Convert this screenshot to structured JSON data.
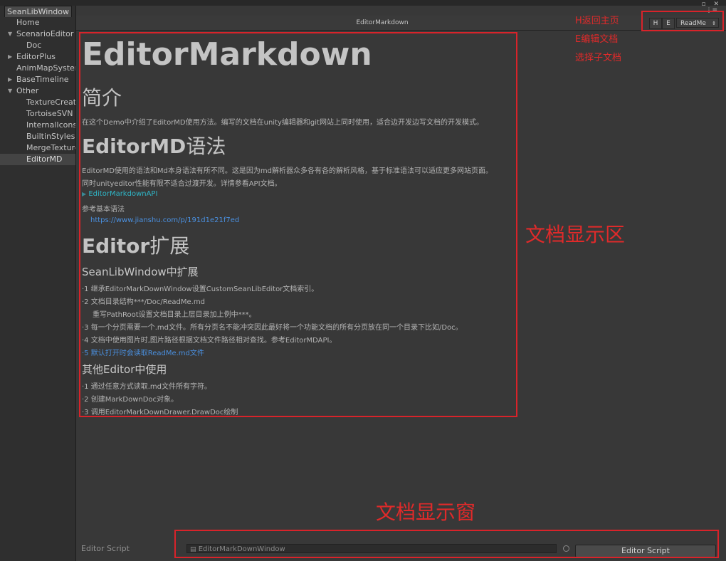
{
  "window": {
    "tab": "SeanLibWindow",
    "controls": "▫ ✕"
  },
  "sidebar": {
    "items": [
      {
        "label": "Home",
        "indent": 1,
        "arrow": "",
        "selected": false
      },
      {
        "label": "ScenarioEditor",
        "indent": 1,
        "arrow": "▼",
        "selected": false
      },
      {
        "label": "Doc",
        "indent": 2,
        "arrow": "",
        "selected": false
      },
      {
        "label": "EditorPlus",
        "indent": 1,
        "arrow": "▶",
        "selected": false
      },
      {
        "label": "AnimMapSystem",
        "indent": 1,
        "arrow": "",
        "selected": false
      },
      {
        "label": "BaseTimeline",
        "indent": 1,
        "arrow": "▶",
        "selected": false
      },
      {
        "label": "Other",
        "indent": 1,
        "arrow": "▼",
        "selected": false
      },
      {
        "label": "TextureCreator",
        "indent": 2,
        "arrow": "",
        "selected": false
      },
      {
        "label": "TortoiseSVN",
        "indent": 2,
        "arrow": "",
        "selected": false
      },
      {
        "label": "InternalIcons",
        "indent": 2,
        "arrow": "",
        "selected": false
      },
      {
        "label": "BuiltinStyles",
        "indent": 2,
        "arrow": "",
        "selected": false
      },
      {
        "label": "MergeTexture",
        "indent": 2,
        "arrow": "",
        "selected": false
      },
      {
        "label": "EditorMD",
        "indent": 2,
        "arrow": "",
        "selected": true
      }
    ]
  },
  "header": {
    "title": "EditorMarkdown",
    "home_button": "H",
    "edit_button": "E",
    "doc_select": "ReadMe",
    "menu_icon": "⋮≡"
  },
  "doc": {
    "h1": "EditorMarkdown",
    "intro_heading": "简介",
    "intro_text": "在这个Demo中介绍了EditorMD使用方法。编写的文档在unity编辑器和git网站上同时使用，适合边开发边写文档的开发模式。",
    "syntax_heading_bold": "EditorMD",
    "syntax_heading_rest": "语法",
    "syntax_line1": "EditorMD使用的语法和Md本身语法有所不同。这是因为md解析器众多各有各的解析风格，基于标准语法可以适应更多网站页面。",
    "syntax_line2": "同时unityeditor性能有限不适合过渡开发。详情参看API文档。",
    "api_link": "EditorMarkdownAPI",
    "ref_label": "参考基本语法",
    "ref_url": "https://www.jianshu.com/p/191d1e21f7ed",
    "ext_heading_bold": "Editor",
    "ext_heading_rest": "扩展",
    "sean_heading": "SeanLibWindow中扩展",
    "sean_items": [
      "·1 继承EditorMarkDownWindow设置CustomSeanLibEditor文档索引。",
      "·2 文档目录结构***/Doc/ReadMe.md",
      "重写PathRoot设置文档目录上层目录加上例中***。",
      "·3 每一个分页需要一个.md文件。所有分页名不能冲突因此最好将一个功能文档的所有分页放在同一个目录下比如/Doc。",
      "·4 文档中使用图片时,图片路径根据文档文件路径相对查找。参考EditorMDAPI。",
      "·5 默认打开时会读取ReadMe.md文件"
    ],
    "other_heading": "其他Editor中使用",
    "other_items": [
      "·1 通过任意方式读取.md文件所有字符。",
      "·2 创建MarkDownDoc对象。",
      "·3 调用EditorMarkDownDrawer.DrawDoc绘制"
    ]
  },
  "bottom": {
    "label": "Editor Script",
    "field_value": "EditorMarkDownWindow",
    "button": "Editor Script"
  },
  "annotations": {
    "h_note": "H返回主页",
    "e_note": "E编辑文档",
    "select_note": "选择子文档",
    "doc_area": "文档显示区",
    "doc_window": "文档显示窗",
    "color": "#d8232a"
  },
  "colors": {
    "link": "#2fb5c6",
    "accent_blue": "#4a90e0",
    "background": "#383838"
  }
}
